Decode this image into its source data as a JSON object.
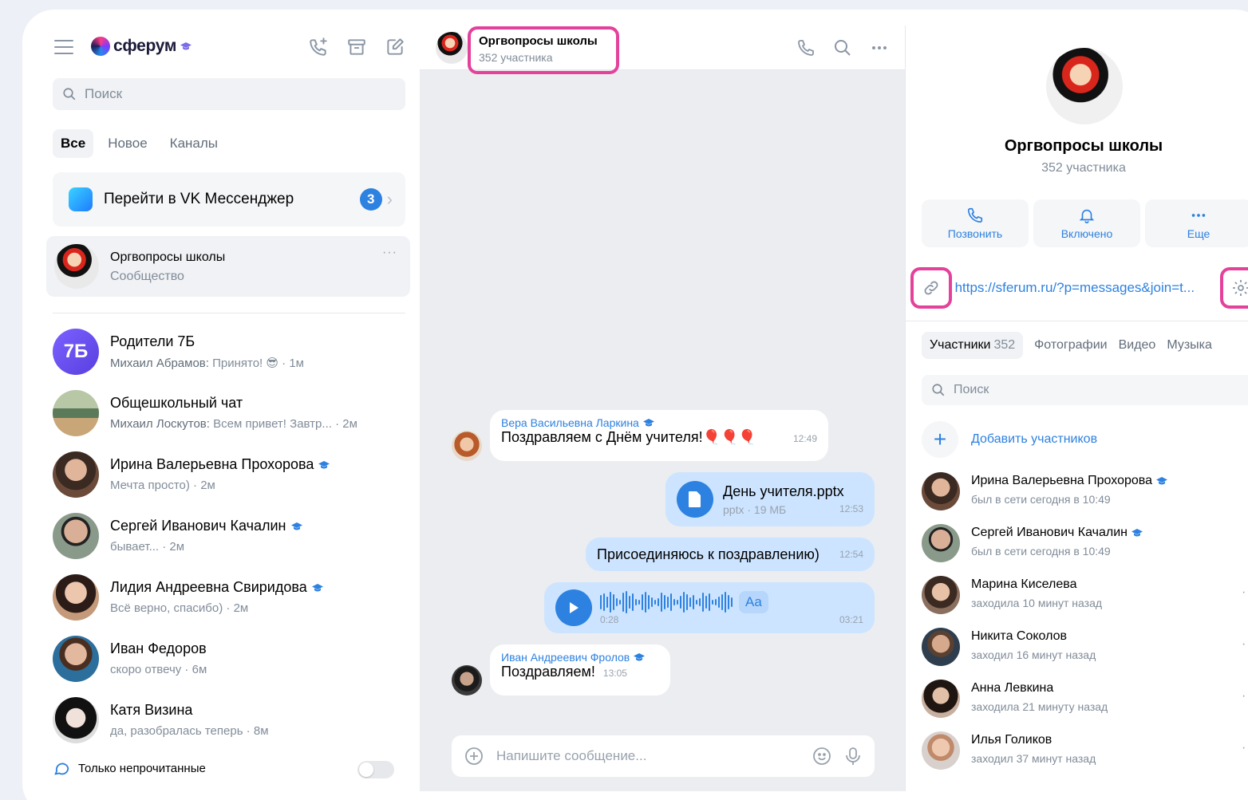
{
  "app": {
    "logo_text": "сферум",
    "brand_color": "#2d81e0",
    "highlight_color": "#e4419b"
  },
  "sidebar": {
    "search_placeholder": "Поиск",
    "tabs": [
      {
        "label": "Все",
        "active": true
      },
      {
        "label": "Новое",
        "active": false
      },
      {
        "label": "Каналы",
        "active": false
      }
    ],
    "vk_messenger": {
      "label": "Перейти в VK Мессенджер",
      "badge": "3"
    },
    "selected_chat": {
      "name": "Оргвопросы школы",
      "subtitle": "Сообщество",
      "more": "···"
    },
    "chats": [
      {
        "name": "Родители 7Б",
        "avatar_text": "7Б",
        "author": "Михаил Абрамов:",
        "preview": " Принято! 😎 · 1м",
        "verified": false
      },
      {
        "name": "Общешкольный чат",
        "author": "Михаил Лоскутов:",
        "preview": " Всем привет! Завтр...   · 2м",
        "verified": false
      },
      {
        "name": "Ирина Валерьевна Прохорова",
        "author": "",
        "preview": "Мечта просто) · 2м",
        "verified": true
      },
      {
        "name": "Сергей Иванович Качалин",
        "author": "",
        "preview": "бывает... · 2м",
        "verified": true
      },
      {
        "name": "Лидия Андреевна Свиридова",
        "author": "",
        "preview": "Всё верно, спасибо) · 2м",
        "verified": true
      },
      {
        "name": "Иван Федоров",
        "author": "",
        "preview": "скоро отвечу · 6м",
        "verified": false
      },
      {
        "name": "Катя Визина",
        "author": "",
        "preview": "да, разобралась теперь · 8м",
        "verified": false
      }
    ],
    "unread_only_label": "Только непрочитанные"
  },
  "chat": {
    "title": "Оргвопросы школы",
    "subtitle": "352 участника",
    "messages": {
      "m1_author": "Вера Васильевна Ларкина",
      "m1_text": "Поздравляем с Днём учителя!🎈🎈🎈",
      "m1_time": "12:49",
      "m2_filename": "День учителя.pptx",
      "m2_meta": "pptx · 19 МБ",
      "m2_time": "12:53",
      "m3_text": "Присоединяюсь к поздравлению)",
      "m3_time": "12:54",
      "m4_elapsed": "0:28",
      "m4_duration": "03:21",
      "m4_aa": "Aa",
      "m5_author": "Иван Андреевич Фролов",
      "m5_text": "Поздравляем!",
      "m5_time": "13:05"
    },
    "composer_placeholder": "Напишите сообщение..."
  },
  "info": {
    "name": "Оргвопросы школы",
    "subtitle": "352 участника",
    "actions": [
      {
        "label": "Позвонить",
        "icon": "phone-icon"
      },
      {
        "label": "Включено",
        "icon": "bell-icon"
      },
      {
        "label": "Еще",
        "icon": "more-icon"
      }
    ],
    "invite_link": "https://sferum.ru/?p=messages&join=t...",
    "tabs": [
      {
        "label": "Участники",
        "count": "352",
        "active": true
      },
      {
        "label": "Фотографии",
        "count": "",
        "active": false
      },
      {
        "label": "Видео",
        "count": "",
        "active": false
      },
      {
        "label": "Музыка",
        "count": "",
        "active": false
      }
    ],
    "search_placeholder": "Поиск",
    "add_members_label": "Добавить участников",
    "members": [
      {
        "name": "Ирина Валерьевна Прохорова",
        "status": "был в сети сегодня в 10:49",
        "verified": true
      },
      {
        "name": "Сергей Иванович Качалин",
        "status": "был в сети сегодня в 10:49",
        "verified": true
      },
      {
        "name": "Марина Киселева",
        "status": "заходила 10 минут назад",
        "verified": false
      },
      {
        "name": "Никита Соколов",
        "status": "заходил 16 минут назад",
        "verified": false
      },
      {
        "name": "Анна Левкина",
        "status": "заходила 21 минуту назад",
        "verified": false
      },
      {
        "name": "Илья Голиков",
        "status": "заходил 37 минут назад",
        "verified": false
      }
    ]
  }
}
